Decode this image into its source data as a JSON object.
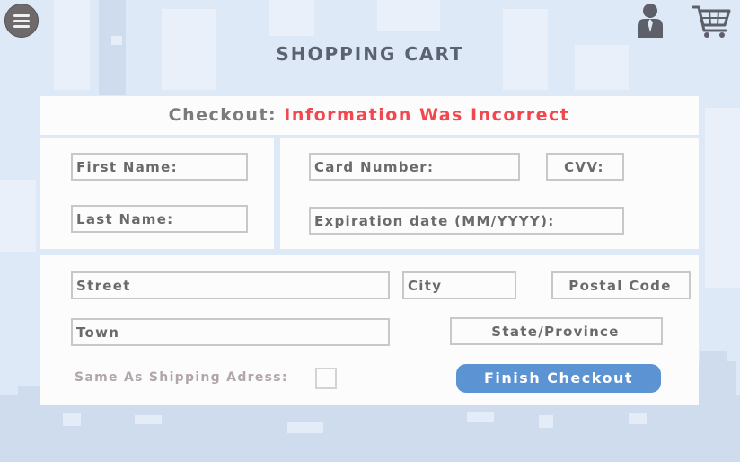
{
  "header": {
    "title": "SHOPPING CART",
    "menu_icon": "hamburger-menu-icon",
    "account_icon": "user-account-icon",
    "cart_icon": "shopping-cart-icon"
  },
  "checkout": {
    "label": "Checkout:",
    "status": "Information Was Incorrect",
    "status_color": "#f2474f"
  },
  "fields": {
    "first_name": "First Name:",
    "last_name": "Last Name:",
    "card_number": "Card Number:",
    "cvv": "CVV:",
    "expiration": "Expiration date (MM/YYYY):",
    "street": "Street",
    "city": "City",
    "postal_code": "Postal Code",
    "town": "Town",
    "state": "State/Province"
  },
  "same_as_shipping": {
    "label": "Same As Shipping Adress:",
    "checked": false
  },
  "finish_button": {
    "label": "Finish Checkout",
    "color": "#5b93d3"
  }
}
